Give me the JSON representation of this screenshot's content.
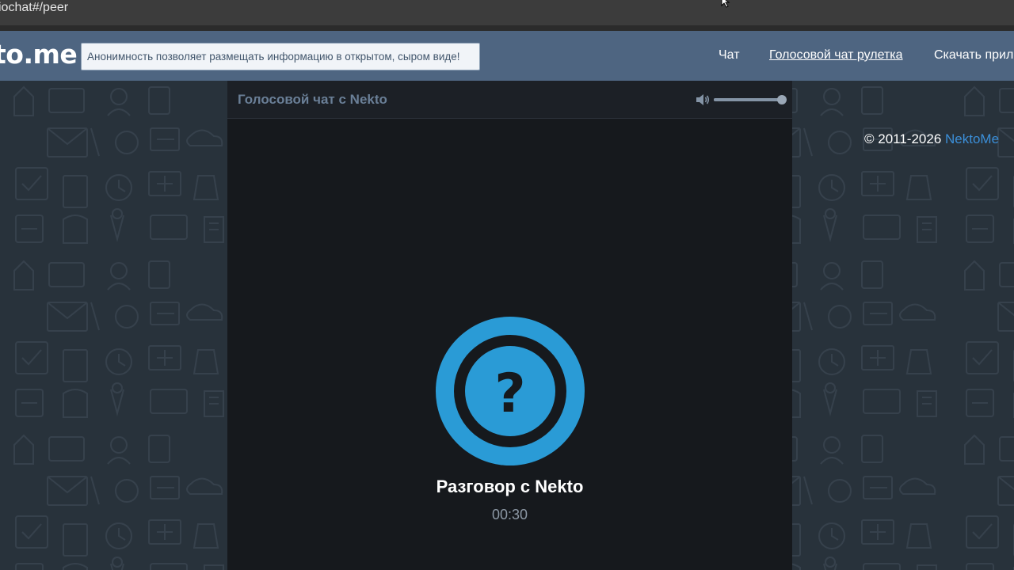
{
  "browser": {
    "url_fragment": "iochat#/peer"
  },
  "header": {
    "logo": "to.me",
    "notice": "Анонимность позволяет размещать информацию в открытом, сыром виде!",
    "nav": {
      "chat": "Чат",
      "roulette": "Голосовой чат рулетка",
      "download": "Скачать прил"
    }
  },
  "panel": {
    "title": "Голосовой чат с Nekto",
    "volume_level": 1.0,
    "avatar_icon": "question-mark-icon",
    "talk_label": "Разговор с Nekto",
    "timer": "00:30"
  },
  "footer": {
    "copyright": "© 2011-2026 ",
    "brand": "NektoMe"
  },
  "colors": {
    "accent": "#2a9bd6",
    "header": "#4e6581",
    "panel": "#16191d",
    "link": "#3b8fd9"
  }
}
